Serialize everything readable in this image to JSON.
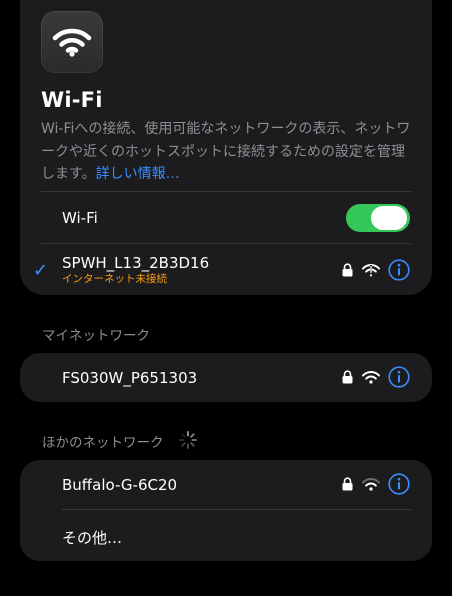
{
  "header": {
    "title": "Wi-Fi",
    "description": "Wi-Fiへの接続、使用可能なネットワークの表示、ネットワークや近くのホットスポットに接続するための設定を管理します。",
    "more_info_link": "詳しい情報…"
  },
  "wifi_toggle": {
    "label": "Wi-Fi",
    "on": true
  },
  "connected_network": {
    "name": "SPWH_L13_2B3D16",
    "status": "インターネット未接続"
  },
  "my_networks": {
    "section_title": "マイネットワーク",
    "items": [
      {
        "name": "FS030W_P651303"
      }
    ]
  },
  "other_networks": {
    "section_title": "ほかのネットワーク",
    "items": [
      {
        "name": "Buffalo-G-6C20"
      },
      {
        "name": "その他…"
      }
    ]
  },
  "colors": {
    "accent": "#3a8dff",
    "toggle_on": "#34c759",
    "warning": "#ff9f0a",
    "card_bg": "#1c1c1e"
  }
}
